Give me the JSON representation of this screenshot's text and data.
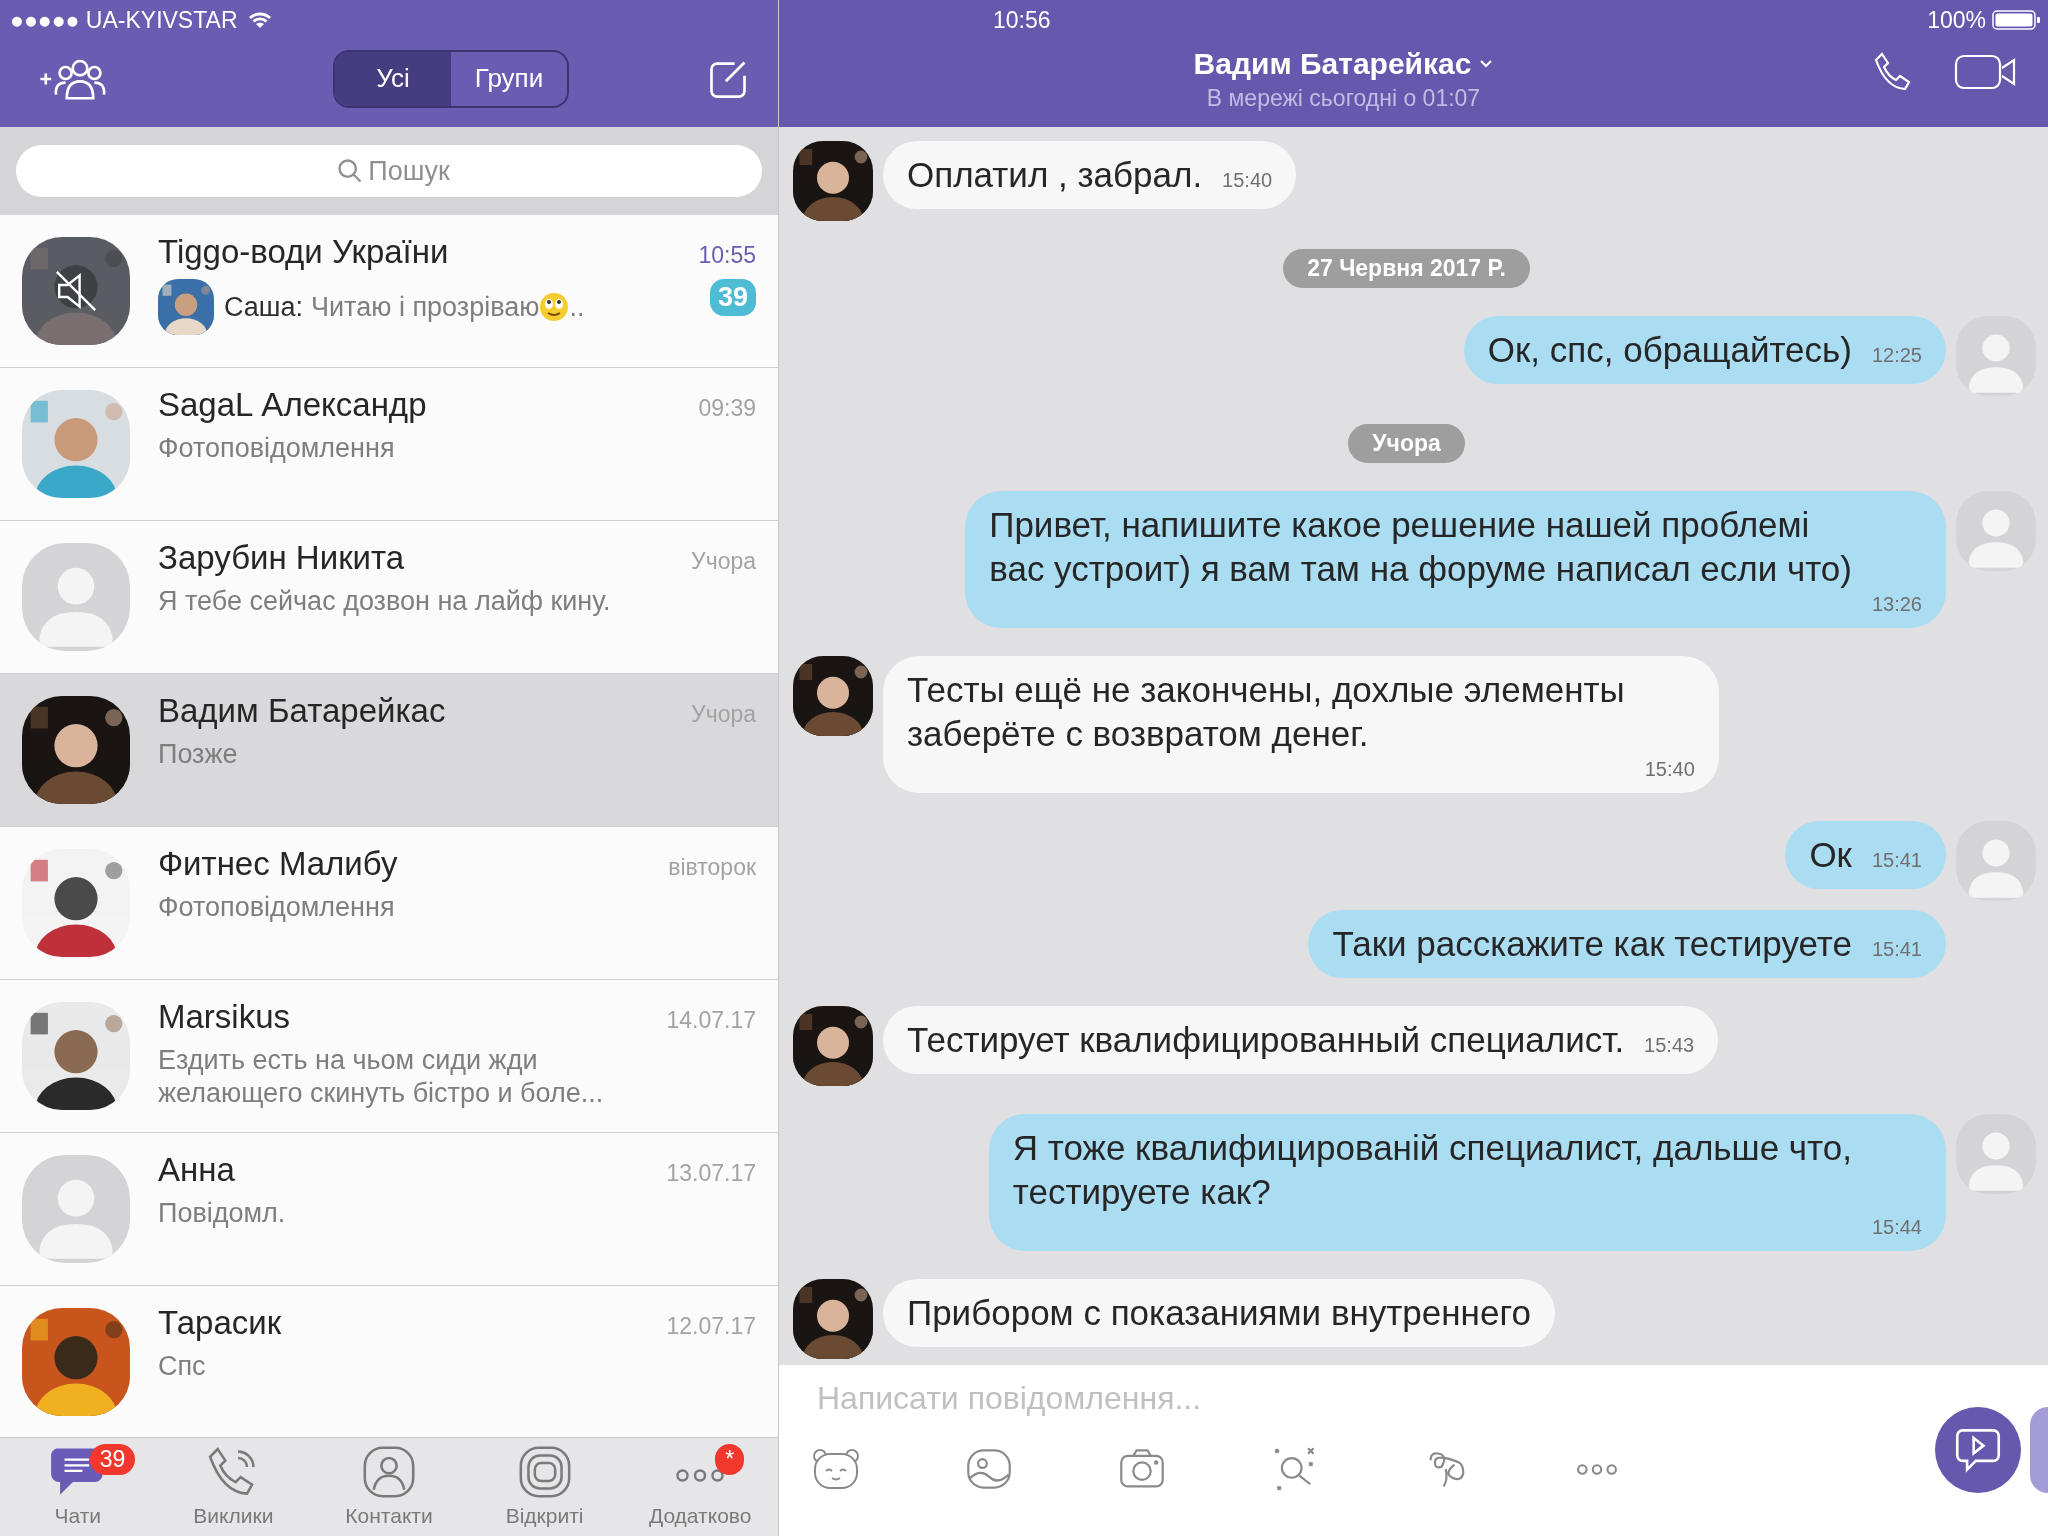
{
  "status_bar": {
    "carrier": "●●●●● UA-KYIVSTAR",
    "time": "10:56",
    "battery": "100%"
  },
  "chats_header": {
    "segments": [
      {
        "label": "Усі",
        "selected": true
      },
      {
        "label": "Групи",
        "selected": false
      }
    ]
  },
  "search": {
    "placeholder": "Пошук"
  },
  "chats": [
    {
      "name": "Tiggo-води України",
      "time": "10:55",
      "muted": true,
      "sender": "Саша:",
      "preview": "Читаю і прозріваю",
      "emoji": true,
      "preview_end": "..",
      "unread": "39",
      "selected": false
    },
    {
      "name": "SagaL Александр",
      "time": "09:39",
      "muted": false,
      "preview": "Фотоповідомлення",
      "emoji": false,
      "selected": false
    },
    {
      "name": "Зарубин Никита",
      "time": "Учора",
      "avatar": {
        "kind": "placeholder"
      },
      "muted": false,
      "preview": "Я тебе сейчас дозвон на лайф кину.",
      "emoji": false,
      "selected": false
    },
    {
      "name": "Вадим Батарейкас",
      "time": "Учора",
      "muted": false,
      "preview": "Позже",
      "emoji": false,
      "selected": true
    },
    {
      "name": "Фитнес Малибу",
      "time": "вівторок",
      "muted": false,
      "preview": "Фотоповідомлення",
      "emoji": false,
      "selected": false
    },
    {
      "name": "Marsikus",
      "time": "14.07.17",
      "muted": false,
      "preview": "Ездить есть на чьом сиди жди\nжелающего скинуть бістро и боле...",
      "emoji": false,
      "selected": false
    },
    {
      "name": "Анна",
      "time": "13.07.17",
      "avatar": {
        "kind": "placeholder"
      },
      "muted": false,
      "preview": "Повідомл.",
      "emoji": false,
      "selected": false
    },
    {
      "name": "Тарасик",
      "time": "12.07.17",
      "muted": false,
      "preview": "Спс",
      "emoji": false,
      "selected": false
    }
  ],
  "tab_bar": [
    {
      "label": "Чати",
      "kind": "chats",
      "badge": "39",
      "selected": true
    },
    {
      "label": "Виклики",
      "kind": "calls",
      "selected": false
    },
    {
      "label": "Контакти",
      "kind": "contacts",
      "selected": false
    },
    {
      "label": "Відкриті",
      "kind": "public",
      "selected": false
    },
    {
      "label": "Додатково",
      "kind": "more",
      "badge": "*",
      "selected": false
    }
  ],
  "conversation": {
    "title": "Вадим Батарейкас",
    "subtitle": "В мережі сьогодні о 01:07"
  },
  "messages": [
    {
      "kind": "incoming",
      "text": "Оплатил , забрал.",
      "time": "15:40"
    },
    {
      "kind": "date",
      "text": "27 Червня 2017 Р."
    },
    {
      "kind": "outgoing",
      "text": "Ок, спс, обращайтесь)",
      "time": "12:25"
    },
    {
      "kind": "date",
      "text": "Учора"
    },
    {
      "kind": "outgoing",
      "text": "Привет, напишите какое решение нашей проблемі\nвас устроит) я вам там на форуме написал если что)",
      "time": "13:26"
    },
    {
      "kind": "incoming",
      "text": "Тесты ещё не закончены, дохлые элементы\nзаберёте с возвратом денег.",
      "time": "15:40"
    },
    {
      "kind": "outgoing",
      "text": "Ок",
      "time": "15:41"
    },
    {
      "kind": "outgoing",
      "text": "Таки расскажите как тестируете",
      "time": "15:41"
    },
    {
      "kind": "incoming",
      "text": "Тестирует квалифицированный специалист.",
      "time": "15:43"
    },
    {
      "kind": "outgoing",
      "text": "Я тоже квалифицированій специалист, дальше что,\nтестируете как?",
      "time": "15:44"
    },
    {
      "kind": "incoming",
      "text": "Прибором с показаниями внутреннего"
    }
  ],
  "composer": {
    "placeholder": "Написати повідомлення..."
  }
}
